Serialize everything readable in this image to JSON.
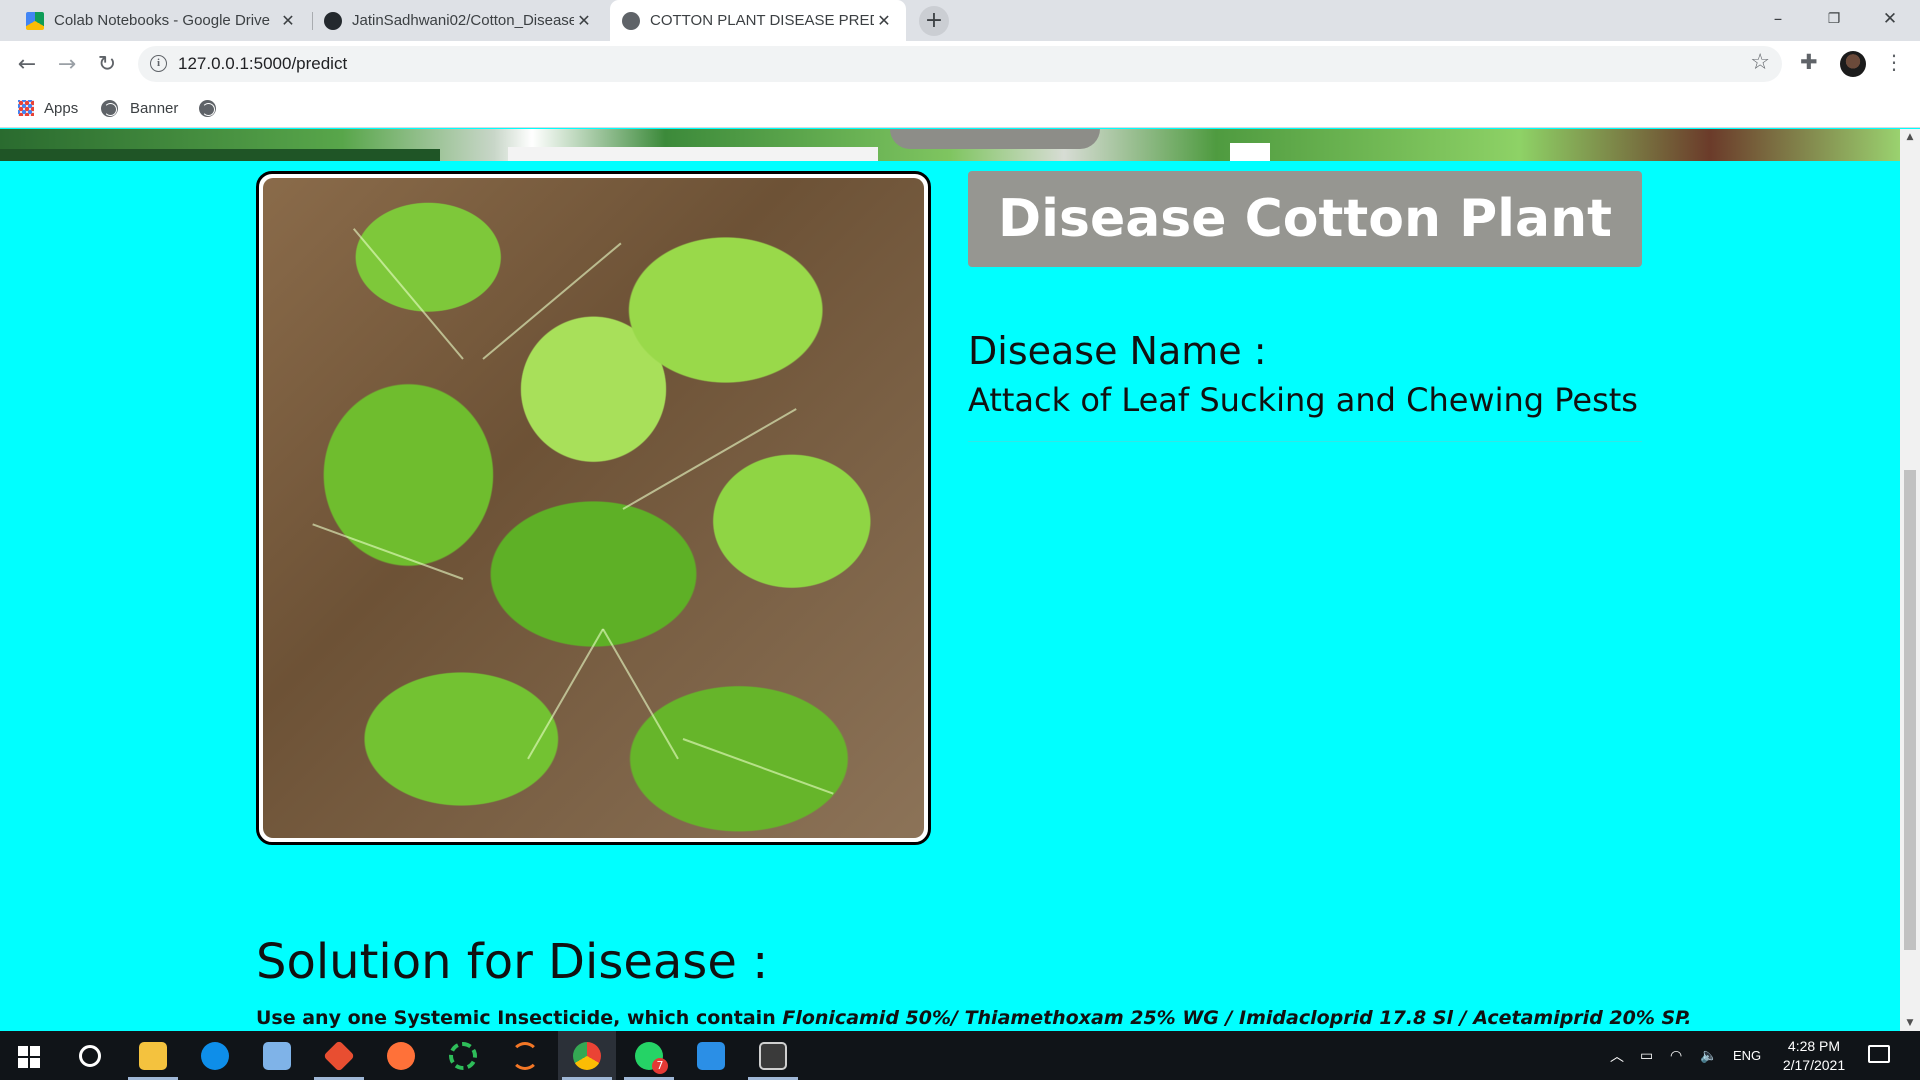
{
  "browser": {
    "tabs": [
      {
        "title": "Colab Notebooks - Google Drive",
        "icon": "google-drive-icon",
        "active": false
      },
      {
        "title": "JatinSadhwani02/Cotton_Disease",
        "icon": "github-icon",
        "active": false
      },
      {
        "title": "COTTON PLANT DISEASE PREDIC",
        "icon": "globe-icon",
        "active": true
      }
    ],
    "new_tab": "+",
    "window_controls": {
      "minimize": "–",
      "restore": "❐",
      "close": "✕"
    },
    "nav": {
      "back": "←",
      "forward": "→",
      "reload": "↻"
    },
    "url": "127.0.0.1:5000/predict",
    "bookmarks": [
      {
        "label": "Apps",
        "icon": "apps-grid-icon"
      },
      {
        "label": "Banner",
        "icon": "globe-icon"
      },
      {
        "label": "",
        "icon": "globe-icon"
      }
    ]
  },
  "page": {
    "title_box": "Disease Cotton Plant",
    "disease_label": "Disease Name :",
    "disease_name": "Attack of Leaf Sucking and Chewing Pests",
    "solution_title": "Solution for Disease :",
    "solution_prefix": "Use any one Systemic Insecticide, which contain ",
    "solution_chemicals": "Flonicamid 50%/ Thiamethoxam 25% WG / Imidacloprid 17.8 Sl / Acetamiprid 20% SP.",
    "background_color": "#00ffff",
    "title_box_color": "#969691"
  },
  "taskbar": {
    "items": [
      {
        "name": "file-explorer-icon",
        "color": "#f4c23e"
      },
      {
        "name": "teamviewer-icon",
        "color": "#0e8ee9"
      },
      {
        "name": "3d-box-icon",
        "color": "#7fb3e8"
      },
      {
        "name": "git-icon",
        "color": "#e84e31"
      },
      {
        "name": "firefox-icon",
        "color": "#ff7139"
      },
      {
        "name": "circle-app-icon",
        "color": "#2ebd59"
      },
      {
        "name": "jupyter-icon",
        "color": "#f37726"
      },
      {
        "name": "chrome-icon",
        "color": "#4285f4"
      },
      {
        "name": "whatsapp-icon",
        "color": "#25d366",
        "badge": "7"
      },
      {
        "name": "vscode-icon",
        "color": "#2b8fe6"
      },
      {
        "name": "terminal-icon",
        "color": "#3a3a3a"
      }
    ],
    "language": "ENG",
    "time": "4:28 PM",
    "date": "2/17/2021"
  }
}
